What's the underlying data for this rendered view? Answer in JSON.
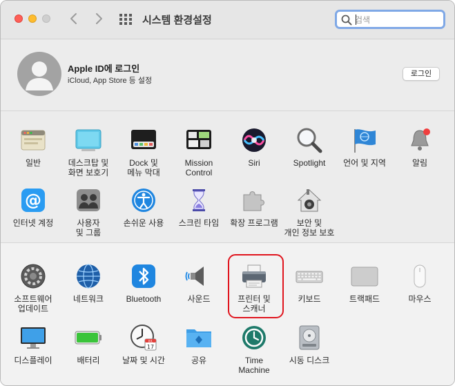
{
  "window": {
    "title": "시스템 환경설정",
    "search_placeholder": "검색"
  },
  "account": {
    "title": "Apple ID에 로그인",
    "subtitle": "iCloud, App Store 등 설정",
    "login_button": "로그인"
  },
  "section1": {
    "row1": [
      {
        "label": "일반",
        "icon": "general-icon"
      },
      {
        "label": "데스크탑 및\n화면 보호기",
        "icon": "desktop-screensaver-icon"
      },
      {
        "label": "Dock 및\n메뉴 막대",
        "icon": "dock-icon"
      },
      {
        "label": "Mission\nControl",
        "icon": "mission-control-icon"
      },
      {
        "label": "Siri",
        "icon": "siri-icon"
      },
      {
        "label": "Spotlight",
        "icon": "spotlight-icon"
      },
      {
        "label": "언어 및 지역",
        "icon": "language-region-icon"
      },
      {
        "label": "알림",
        "icon": "notifications-icon"
      }
    ],
    "row2": [
      {
        "label": "인터넷 계정",
        "icon": "internet-accounts-icon"
      },
      {
        "label": "사용자\n및 그룹",
        "icon": "users-groups-icon"
      },
      {
        "label": "손쉬운 사용",
        "icon": "accessibility-icon"
      },
      {
        "label": "스크린 타임",
        "icon": "screen-time-icon"
      },
      {
        "label": "확장 프로그램",
        "icon": "extensions-icon"
      },
      {
        "label": "보안 및\n개인 정보 보호",
        "icon": "security-privacy-icon"
      }
    ]
  },
  "section2": {
    "row1": [
      {
        "label": "소프트웨어\n업데이트",
        "icon": "software-update-icon"
      },
      {
        "label": "네트워크",
        "icon": "network-icon"
      },
      {
        "label": "Bluetooth",
        "icon": "bluetooth-icon"
      },
      {
        "label": "사운드",
        "icon": "sound-icon"
      },
      {
        "label": "프린터 및\n스캐너",
        "icon": "printer-icon"
      },
      {
        "label": "키보드",
        "icon": "keyboard-icon"
      },
      {
        "label": "트랙패드",
        "icon": "trackpad-icon"
      },
      {
        "label": "마우스",
        "icon": "mouse-icon"
      }
    ],
    "row2": [
      {
        "label": "디스플레이",
        "icon": "displays-icon"
      },
      {
        "label": "배터리",
        "icon": "battery-icon"
      },
      {
        "label": "날짜 및 시간",
        "icon": "date-time-icon",
        "calendar_day": "17",
        "calendar_month": "JUL"
      },
      {
        "label": "공유",
        "icon": "sharing-icon"
      },
      {
        "label": "Time\nMachine",
        "icon": "time-machine-icon"
      },
      {
        "label": "시동 디스크",
        "icon": "startup-disk-icon"
      }
    ]
  },
  "colors": {
    "highlight_ring": "#e0141d",
    "search_focus": "#7fa8e6",
    "close": "#fe5f57",
    "minimize": "#febc2e"
  }
}
